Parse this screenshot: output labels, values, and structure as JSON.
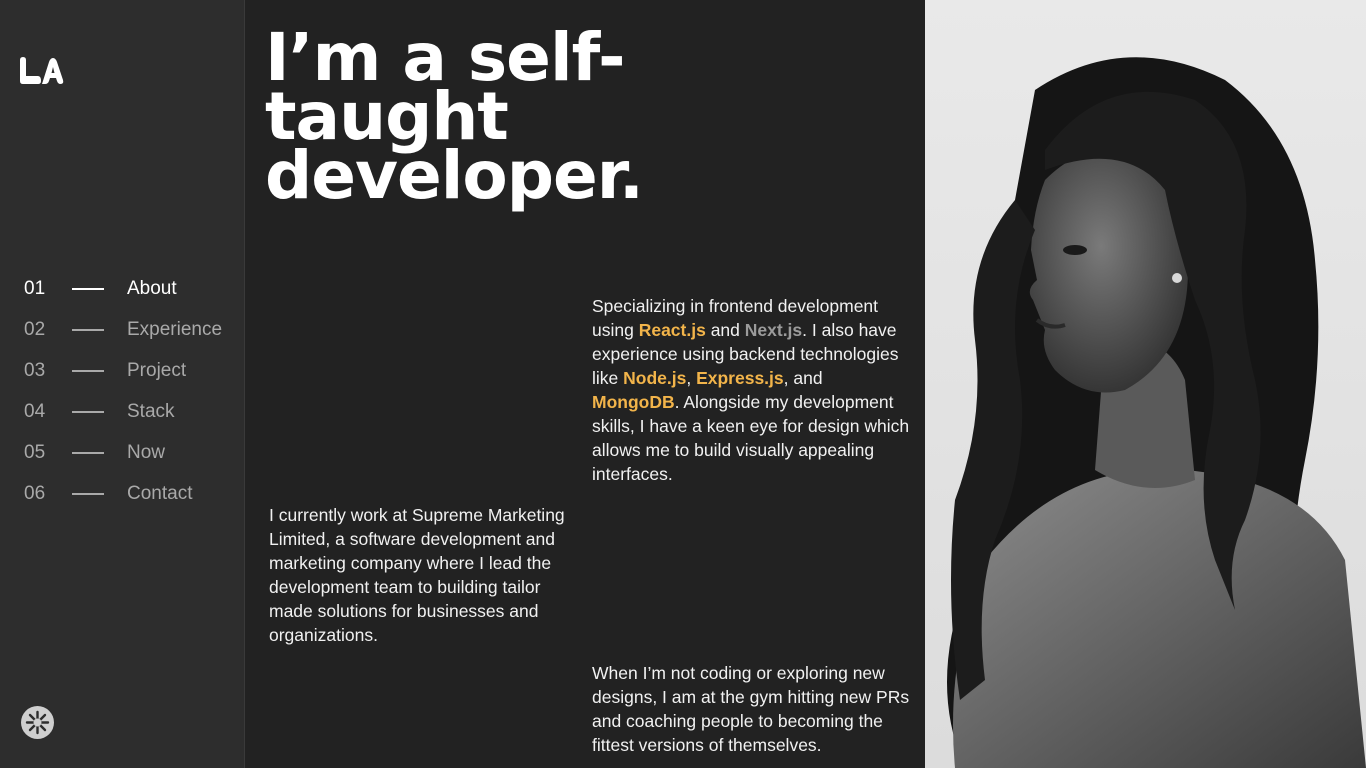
{
  "logo": {
    "icon": "la-logo-icon",
    "text": "LA"
  },
  "nav": [
    {
      "num": "01",
      "label": "About",
      "active": true
    },
    {
      "num": "02",
      "label": "Experience"
    },
    {
      "num": "03",
      "label": "Project"
    },
    {
      "num": "04",
      "label": "Stack"
    },
    {
      "num": "05",
      "label": "Now"
    },
    {
      "num": "06",
      "label": "Contact"
    }
  ],
  "theme_toggle": {
    "icon": "sun-icon"
  },
  "headline": "I’m a self-taught developer.",
  "p1": {
    "t1": "Specializing in frontend development using ",
    "react": "React.js",
    "t2": " and ",
    "next": "Next.js",
    "t3": ". I also have experience using backend technologies like ",
    "node": "Node.js",
    "t4": ", ",
    "express": "Express.js",
    "t5": ", and ",
    "mongo": "MongoDB",
    "t6": ". Alongside my development skills, I have a keen eye for design which allows me to build visually appealing interfaces."
  },
  "p2": "I currently work at Supreme Marketing Limited, a software development and marketing company where I lead the development team to building tailor made solutions for businesses and organizations.",
  "p3": "When I’m not coding or exploring new designs, I am at the gym hitting new PRs and coaching people to becoming the fittest versions of themselves.",
  "colors": {
    "accent": "#f2b44a",
    "background": "#222222",
    "sidebar": "#2d2d2d"
  }
}
